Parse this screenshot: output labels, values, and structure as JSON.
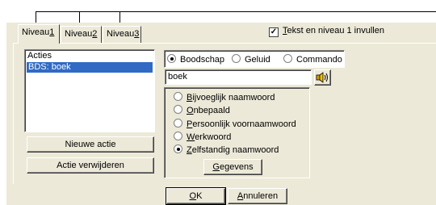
{
  "tabs": [
    {
      "label_pre": "Niveau",
      "label_key": "1",
      "active": true
    },
    {
      "label_pre": "Niveau",
      "label_key": "2",
      "active": false
    },
    {
      "label_pre": "Niveau",
      "label_key": "3",
      "active": false
    }
  ],
  "top_checkbox": {
    "key": "T",
    "rest": "ekst en niveau 1 invullen",
    "checked": true
  },
  "acties": {
    "label": "Acties",
    "items": [
      "BDS: boek"
    ],
    "new_button": "Nieuwe actie",
    "delete_button": "Actie verwijderen"
  },
  "mode_radios": [
    {
      "label": "Boodschap",
      "selected": true
    },
    {
      "label": "Geluid",
      "selected": false
    },
    {
      "label": "Commando",
      "selected": false
    }
  ],
  "text_field": {
    "value": "boek"
  },
  "type_radios": [
    {
      "key": "B",
      "rest": "ijvoeglijk naamwoord",
      "selected": false
    },
    {
      "key": "O",
      "rest": "nbepaald",
      "selected": false
    },
    {
      "key": "P",
      "rest": "ersoonlijk voornaamwoord",
      "selected": false
    },
    {
      "key": "W",
      "rest": "erkwoord",
      "selected": false
    },
    {
      "key": "Z",
      "rest": "elfstandig naamwoord",
      "selected": true
    }
  ],
  "gegevens_button": {
    "key": "G",
    "rest": "egevens"
  },
  "footer": {
    "ok": {
      "key": "O",
      "rest": "K"
    },
    "cancel": {
      "key": "A",
      "rest": "nnuleren"
    }
  },
  "icons": {
    "speaker": "speaker-icon"
  }
}
